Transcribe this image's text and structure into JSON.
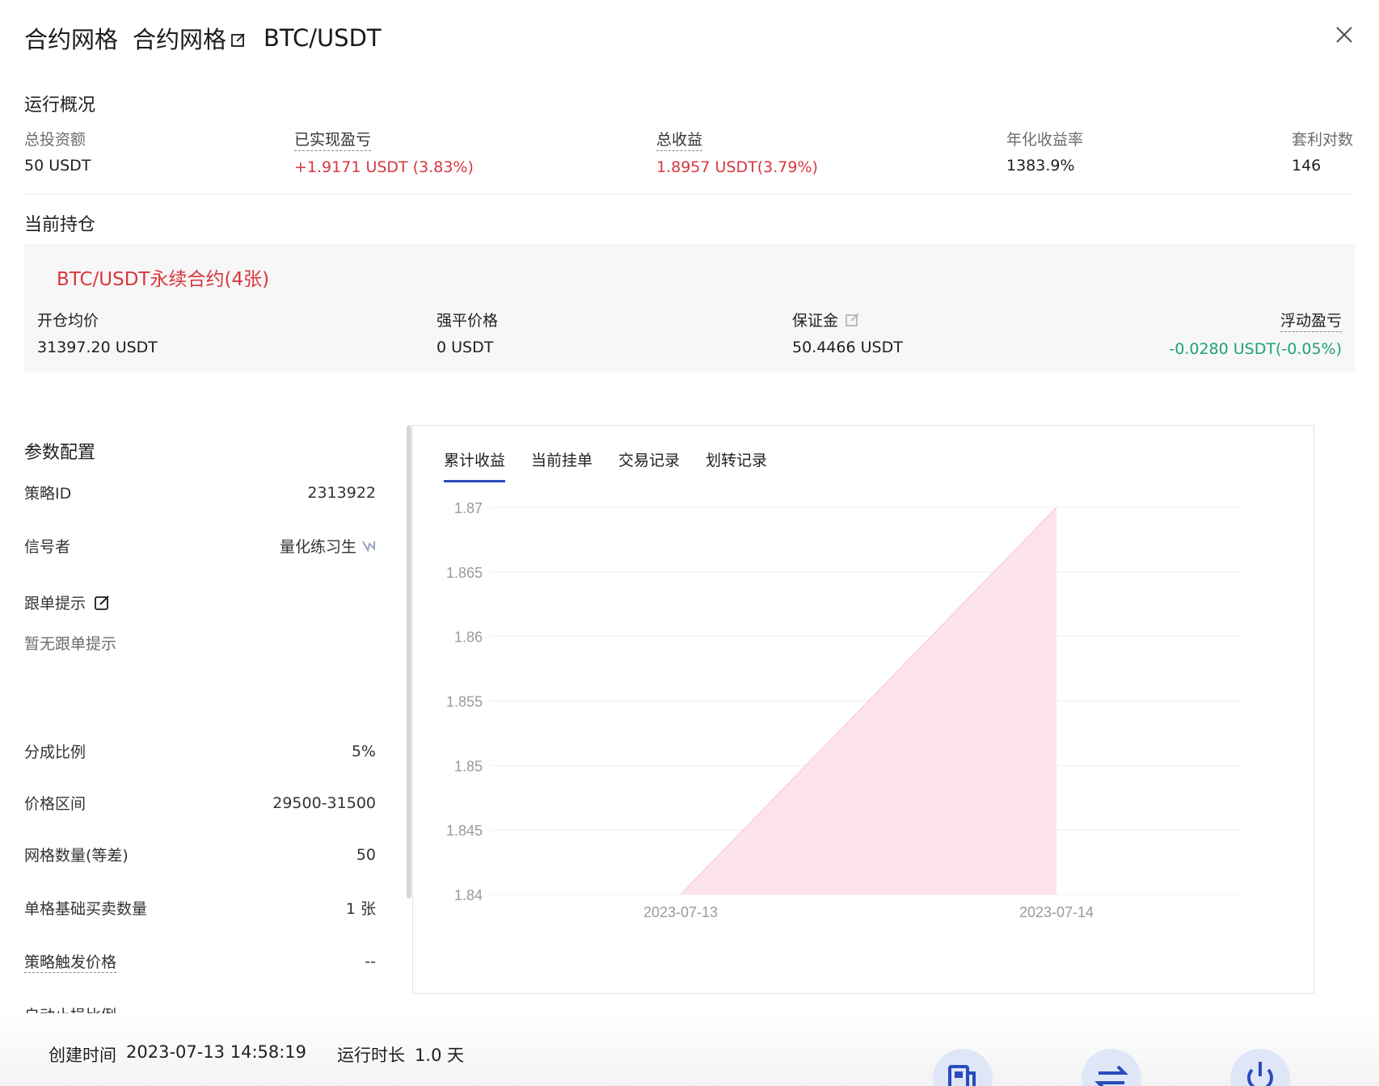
{
  "header": {
    "type": "合约网格",
    "name": "合约网格",
    "pair": "BTC/USDT"
  },
  "overview": {
    "title": "运行概况",
    "stats": [
      {
        "label": "总投资额",
        "value": "50 USDT"
      },
      {
        "label": "已实现盈亏",
        "value": "+1.9171 USDT (3.83%)"
      },
      {
        "label": "总收益",
        "value": "1.8957 USDT(3.79%)"
      },
      {
        "label": "年化收益率",
        "value": "1383.9%"
      },
      {
        "label": "套利对数",
        "value": "146"
      }
    ]
  },
  "position": {
    "title": "当前持仓",
    "contract": "BTC/USDT永续合约(4张)",
    "items": [
      {
        "label": "开仓均价",
        "value": "31397.20 USDT"
      },
      {
        "label": "强平价格",
        "value": "0 USDT"
      },
      {
        "label": "保证金",
        "value": "50.4466 USDT"
      },
      {
        "label": "浮动盈亏",
        "value": "-0.0280 USDT(-0.05%)"
      }
    ]
  },
  "params": {
    "title": "参数配置",
    "strategy_id_label": "策略ID",
    "strategy_id": "2313922",
    "signaler_label": "信号者",
    "signaler": "量化练习生",
    "follow_tip_label": "跟单提示",
    "follow_tip_value": "暂无跟单提示",
    "rows": [
      {
        "label": "分成比例",
        "value": "5%"
      },
      {
        "label": "价格区间",
        "value": "29500-31500"
      },
      {
        "label": "网格数量(等差)",
        "value": "50"
      },
      {
        "label": "单格基础买卖数量",
        "value": "1 张"
      },
      {
        "label": "策略触发价格",
        "value": "--"
      },
      {
        "label": "自动止损比例",
        "value": ""
      }
    ]
  },
  "tabs": [
    "累计收益",
    "当前挂单",
    "交易记录",
    "划转记录"
  ],
  "chart_data": {
    "type": "area",
    "x": [
      "2023-07-13",
      "2023-07-14"
    ],
    "series": [
      {
        "values": [
          1.84,
          1.87
        ]
      }
    ],
    "ylim": [
      1.84,
      1.87
    ],
    "yticks": [
      "1.87",
      "1.865",
      "1.86",
      "1.855",
      "1.85",
      "1.845",
      "1.84"
    ],
    "color": "#fde4ea",
    "grid": true
  },
  "footer": {
    "created_label": "创建时间",
    "created_value": "2023-07-13 14:58:19",
    "duration_label": "运行时长",
    "duration_value": "1.0 天"
  },
  "colors": {
    "red": "#d9363e",
    "green": "#1ea36e",
    "accent": "#2a4bbd"
  }
}
